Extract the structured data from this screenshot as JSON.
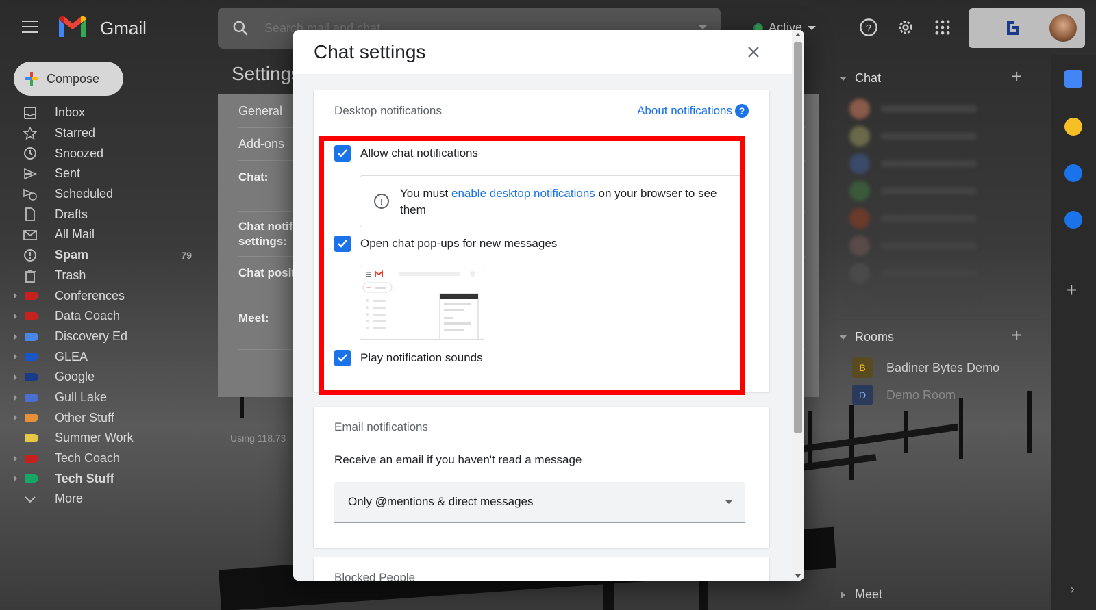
{
  "app": {
    "name": "Gmail",
    "search_placeholder": "Search mail and chat",
    "status": "Active",
    "status_color": "#34a853"
  },
  "compose": {
    "label": "Compose"
  },
  "nav": [
    {
      "label": "Inbox",
      "icon": "inbox-icon",
      "bold": false,
      "count": ""
    },
    {
      "label": "Starred",
      "icon": "star-icon",
      "bold": false,
      "count": ""
    },
    {
      "label": "Snoozed",
      "icon": "clock-icon",
      "bold": false,
      "count": ""
    },
    {
      "label": "Sent",
      "icon": "send-icon",
      "bold": false,
      "count": ""
    },
    {
      "label": "Scheduled",
      "icon": "scheduled-icon",
      "bold": false,
      "count": ""
    },
    {
      "label": "Drafts",
      "icon": "draft-icon",
      "bold": false,
      "count": ""
    },
    {
      "label": "All Mail",
      "icon": "mail-icon",
      "bold": false,
      "count": ""
    },
    {
      "label": "Spam",
      "icon": "spam-icon",
      "bold": true,
      "count": "79"
    },
    {
      "label": "Trash",
      "icon": "trash-icon",
      "bold": false,
      "count": ""
    }
  ],
  "labels": [
    {
      "label": "Conferences",
      "color": "#c5221f",
      "bold": false,
      "expandable": true
    },
    {
      "label": "Data Coach",
      "color": "#c5221f",
      "bold": false,
      "expandable": true
    },
    {
      "label": "Discovery Ed",
      "color": "#4a86e8",
      "bold": false,
      "expandable": true
    },
    {
      "label": "GLEA",
      "color": "#1a56c4",
      "bold": false,
      "expandable": true
    },
    {
      "label": "Google",
      "color": "#1a3a8a",
      "bold": false,
      "expandable": true
    },
    {
      "label": "Gull Lake",
      "color": "#4a6fd0",
      "bold": false,
      "expandable": true
    },
    {
      "label": "Other Stuff",
      "color": "#e69138",
      "bold": false,
      "expandable": true
    },
    {
      "label": "Summer Work",
      "color": "#e6c847",
      "bold": false,
      "expandable": false
    },
    {
      "label": "Tech Coach",
      "color": "#c5221f",
      "bold": false,
      "expandable": true
    },
    {
      "label": "Tech Stuff",
      "color": "#16a765",
      "bold": true,
      "expandable": true
    }
  ],
  "more_label": "More",
  "settings": {
    "title": "Settings",
    "tabs": [
      "General",
      "Add-ons"
    ],
    "rows": [
      "Chat:",
      "Chat notif\nsettings:",
      "Chat posit",
      "Meet:"
    ],
    "storage": "Using 118.73"
  },
  "right_panel": {
    "chat_header": "Chat",
    "rooms_header": "Rooms",
    "rooms": [
      {
        "badge": "B",
        "name": "Badiner Bytes Demo",
        "color": "#f6bf26"
      },
      {
        "badge": "D",
        "name": "Demo Room",
        "color": "#8ab4f8"
      }
    ],
    "meet_label": "Meet"
  },
  "modal": {
    "title": "Chat settings",
    "desktop": {
      "heading": "Desktop notifications",
      "about_link": "About notifications",
      "allow": {
        "label": "Allow chat notifications",
        "checked": true
      },
      "info_prefix": "You must ",
      "info_link": "enable desktop notifications",
      "info_suffix": " on your browser to see them",
      "popups": {
        "label": "Open chat pop-ups for new messages",
        "checked": true
      },
      "sounds": {
        "label": "Play notification sounds",
        "checked": true
      }
    },
    "email": {
      "heading": "Email notifications",
      "description": "Receive an email if you haven't read a message",
      "selected": "Only @mentions & direct messages"
    },
    "blocked": {
      "heading": "Blocked People"
    }
  },
  "colors": {
    "accent": "#1a73e8",
    "highlight": "#ff0000"
  }
}
